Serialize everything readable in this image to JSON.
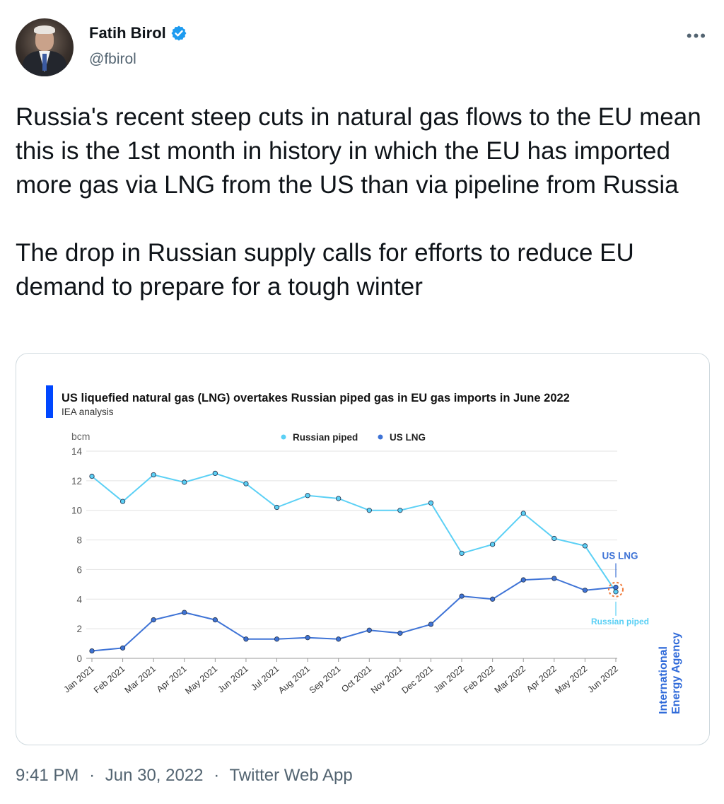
{
  "author": {
    "name": "Fatih Birol",
    "handle": "@fbirol"
  },
  "icons": {
    "verified": "verified-badge-icon",
    "more": "more-options-icon",
    "verified_color": "#1d9bf0"
  },
  "tweet": {
    "paragraph1": "Russia's recent steep cuts in natural gas flows to the EU mean this is the 1st month in history in which the EU has imported more gas via LNG from the US than via pipeline from Russia",
    "paragraph2": "The drop in Russian supply calls for efforts to reduce EU demand to prepare for a tough winter"
  },
  "footer": {
    "time": "9:41 PM",
    "sep1": "·",
    "date": "Jun 30, 2022",
    "sep2": "·",
    "source": "Twitter Web App"
  },
  "chart_data": {
    "type": "line",
    "title": "US liquefied natural gas (LNG) overtakes Russian piped gas in EU gas imports in June 2022",
    "subtitle": "IEA analysis",
    "ylabel": "bcm",
    "ylim": [
      0,
      14
    ],
    "yticks": [
      0,
      2,
      4,
      6,
      8,
      10,
      12,
      14
    ],
    "grid": true,
    "legend_position": "top",
    "categories": [
      "Jan 2021",
      "Feb 2021",
      "Mar 2021",
      "Apr 2021",
      "May 2021",
      "Jun 2021",
      "Jul 2021",
      "Aug 2021",
      "Sep 2021",
      "Oct 2021",
      "Nov 2021",
      "Dec 2021",
      "Jan 2022",
      "Feb 2022",
      "Mar 2022",
      "Apr 2022",
      "May 2022",
      "Jun 2022"
    ],
    "series": [
      {
        "name": "Russian piped",
        "color": "#5bd0f5",
        "values": [
          12.3,
          10.6,
          12.4,
          11.9,
          12.5,
          11.8,
          10.2,
          11.0,
          10.8,
          10.0,
          10.0,
          10.5,
          7.1,
          7.7,
          9.8,
          8.1,
          7.6,
          4.5
        ]
      },
      {
        "name": "US LNG",
        "color": "#3e73d6",
        "values": [
          0.5,
          0.7,
          2.6,
          3.1,
          2.6,
          1.3,
          1.3,
          1.4,
          1.3,
          1.9,
          1.7,
          2.3,
          4.2,
          4.0,
          5.3,
          5.4,
          4.6,
          4.8
        ]
      }
    ],
    "annotations": [
      {
        "label": "US LNG",
        "color": "#3e73d6"
      },
      {
        "label": "Russian piped",
        "color": "#5bd0f5"
      }
    ],
    "accent_color": "#0047ff",
    "brand": "International Energy Agency",
    "brand_color": "#2f6ad9"
  }
}
